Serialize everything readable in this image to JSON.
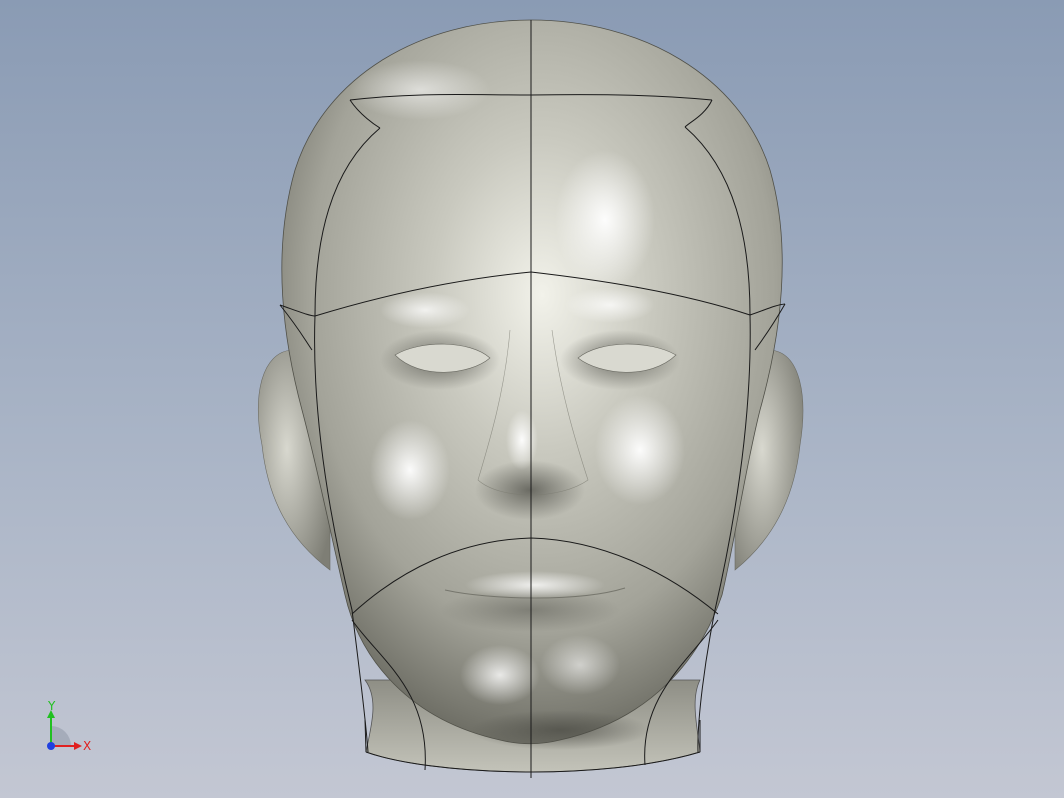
{
  "viewport": {
    "background_top": "#8a9bb4",
    "background_bottom": "#c3c7d3",
    "model_color": "#b9b9ae"
  },
  "triad": {
    "x_label": "X",
    "y_label": "Y",
    "x_color": "#e02020",
    "y_color": "#20c020",
    "z_color": "#2040e0"
  }
}
